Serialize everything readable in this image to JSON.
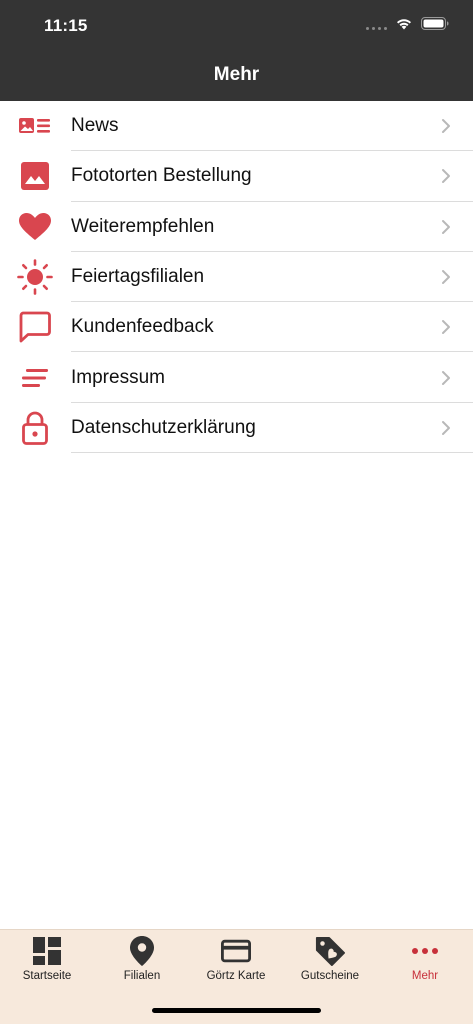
{
  "status_bar": {
    "time": "11:15"
  },
  "header": {
    "title": "Mehr"
  },
  "menu": {
    "items": [
      {
        "label": "News",
        "icon": "news-icon"
      },
      {
        "label": "Fototorten Bestellung",
        "icon": "image-icon"
      },
      {
        "label": "Weiterempfehlen",
        "icon": "heart-icon"
      },
      {
        "label": "Feiertagsfilialen",
        "icon": "sun-icon"
      },
      {
        "label": "Kundenfeedback",
        "icon": "chat-bubble-icon"
      },
      {
        "label": "Impressum",
        "icon": "lines-icon"
      },
      {
        "label": "Datenschutzerklärung",
        "icon": "lock-icon"
      }
    ]
  },
  "tabbar": {
    "tabs": [
      {
        "label": "Startseite",
        "icon": "dashboard-icon",
        "active": false
      },
      {
        "label": "Filialen",
        "icon": "location-pin-icon",
        "active": false
      },
      {
        "label": "Görtz Karte",
        "icon": "credit-card-icon",
        "active": false
      },
      {
        "label": "Gutscheine",
        "icon": "tag-heart-icon",
        "active": false
      },
      {
        "label": "Mehr",
        "icon": "more-dots-icon",
        "active": true
      }
    ]
  },
  "colors": {
    "header_bg": "#343434",
    "accent": "#d9464f",
    "active_tab": "#c7303a",
    "tabbar_bg": "#f7e9dc"
  }
}
